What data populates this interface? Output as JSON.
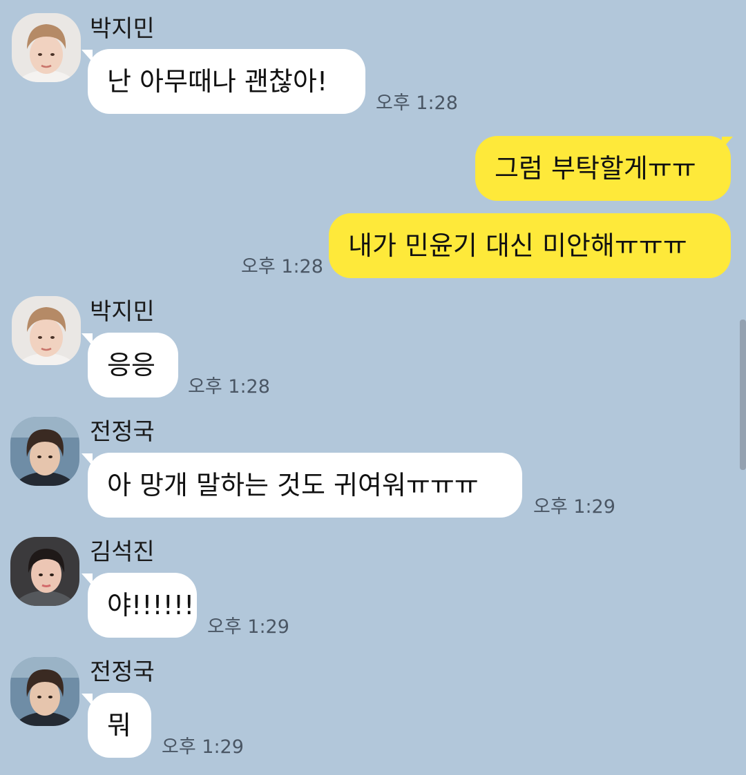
{
  "messages": [
    {
      "sender": "박지민",
      "text": "난 아무때나 괜찮아!",
      "time": "오후 1:28",
      "direction": "incoming"
    },
    {
      "text": "그럼 부탁할게ㅠㅠ",
      "direction": "outgoing"
    },
    {
      "text": "내가 민윤기 대신 미안해ㅠㅠㅠ",
      "time": "오후 1:28",
      "direction": "outgoing"
    },
    {
      "sender": "박지민",
      "text": "응응",
      "time": "오후 1:28",
      "direction": "incoming"
    },
    {
      "sender": "전정국",
      "text": "아 망개 말하는 것도 귀여워ㅠㅠㅠ",
      "time": "오후 1:29",
      "direction": "incoming"
    },
    {
      "sender": "김석진",
      "text": "야!!!!!!",
      "time": "오후 1:29",
      "direction": "incoming"
    },
    {
      "sender": "전정국",
      "text": "뭐",
      "time": "오후 1:29",
      "direction": "incoming"
    }
  ],
  "colors": {
    "background": "#b2c7da",
    "incoming_bubble": "#ffffff",
    "outgoing_bubble": "#fee93a"
  },
  "icons": [
    "avatar-jimin",
    "avatar-jungkook",
    "avatar-seokjin"
  ]
}
